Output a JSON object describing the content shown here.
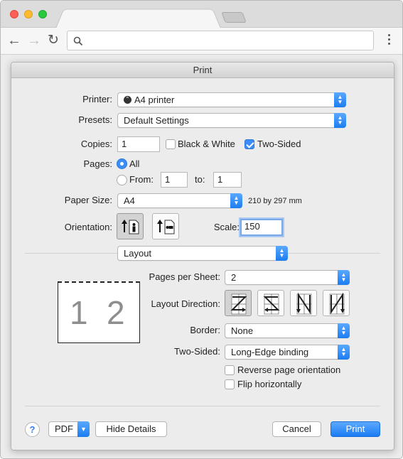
{
  "dialog": {
    "title": "Print"
  },
  "printer": {
    "label": "Printer:",
    "value": "A4 printer"
  },
  "presets": {
    "label": "Presets:",
    "value": "Default Settings"
  },
  "copies": {
    "label": "Copies:",
    "value": "1",
    "black_white": {
      "label": "Black & White",
      "checked": false
    },
    "two_sided": {
      "label": "Two-Sided",
      "checked": true
    }
  },
  "pages": {
    "label": "Pages:",
    "all_label": "All",
    "from_label": "From:",
    "to_label": "to:",
    "from_value": "1",
    "to_value": "1",
    "selected": "All"
  },
  "paper_size": {
    "label": "Paper Size:",
    "value": "A4",
    "dimensions": "210 by 297 mm"
  },
  "orientation": {
    "label": "Orientation:",
    "selected": "portrait",
    "options": [
      "portrait",
      "landscape"
    ]
  },
  "scale": {
    "label": "Scale:",
    "value": "150"
  },
  "section": {
    "value": "Layout"
  },
  "preview": {
    "page_numbers": [
      "1",
      "2"
    ]
  },
  "layout": {
    "pages_per_sheet": {
      "label": "Pages per Sheet:",
      "value": "2"
    },
    "layout_direction": {
      "label": "Layout Direction:",
      "selected": 0,
      "options": [
        "Z",
        "reverse-Z",
        "N-reverse",
        "N"
      ]
    },
    "border": {
      "label": "Border:",
      "value": "None"
    },
    "two_sided": {
      "label": "Two-Sided:",
      "value": "Long-Edge binding"
    },
    "reverse_orientation": {
      "label": "Reverse page orientation",
      "checked": false
    },
    "flip_horizontally": {
      "label": "Flip horizontally",
      "checked": false
    }
  },
  "footer": {
    "help": "?",
    "pdf": "PDF",
    "hide_details": "Hide Details",
    "cancel": "Cancel",
    "print": "Print"
  },
  "colors": {
    "accent": "#1a7cf3",
    "focus_ring": "#76a7e6"
  }
}
